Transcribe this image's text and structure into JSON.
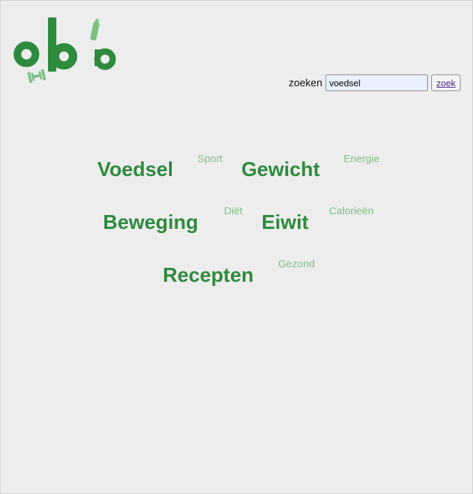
{
  "logo": {
    "text": "ob'a"
  },
  "search": {
    "label": "zoeken",
    "value": "voedsel",
    "button": "zoek"
  },
  "cloud": {
    "voedsel": "Voedsel",
    "sport": "Sport",
    "gewicht": "Gewicht",
    "energie": "Energie",
    "beweging": "Beweging",
    "diet": "Diët",
    "eiwit": "Eiwit",
    "calorieen": "Calorieën",
    "recepten": "Recepten",
    "gezond": "Gezond"
  },
  "colors": {
    "primary": "#2e8b3e",
    "secondary": "#7cc285"
  }
}
